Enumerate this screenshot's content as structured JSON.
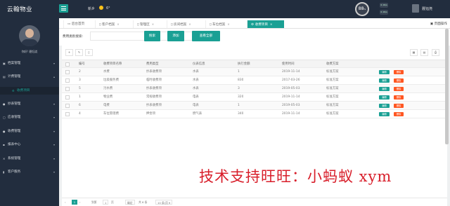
{
  "app": {
    "title": "云翰物业"
  },
  "topbar": {
    "city": "新乡",
    "temperature": "6°",
    "gauge": "88",
    "gauge_unit": "%",
    "stat_a": "0.1K/s",
    "stat_b": "0.1K/s",
    "user_name": "聂钰尧"
  },
  "sidebar": {
    "welcome": "你好! 聂钰尧",
    "items": [
      {
        "label": "档案管理",
        "icon": "archive-icon"
      },
      {
        "label": "计费管理",
        "icon": "billing-icon"
      },
      {
        "label": "收费项目",
        "icon": "gear-icon",
        "active": true
      },
      {
        "label": "抄表管理",
        "icon": "meter-icon"
      },
      {
        "label": "应收管理",
        "icon": "receivable-icon"
      },
      {
        "label": "收费管理",
        "icon": "cash-icon"
      },
      {
        "label": "报表中心",
        "icon": "report-icon"
      },
      {
        "label": "系统管理",
        "icon": "system-icon"
      },
      {
        "label": "客户服务",
        "icon": "service-icon"
      }
    ]
  },
  "tabs": [
    {
      "label": "后台首页",
      "closable": false
    },
    {
      "label": "客户档案",
      "closable": true
    },
    {
      "label": "管理区",
      "closable": true
    },
    {
      "label": "房间档案",
      "closable": true
    },
    {
      "label": "车位档案",
      "closable": true
    },
    {
      "label": "收费项目",
      "closable": true,
      "active": true
    }
  ],
  "page_ops": "页面操作",
  "search": {
    "label": "费用类别搜索:",
    "value": "",
    "search_button": "搜索",
    "add_button": "添加",
    "view_all_button": "查看全部"
  },
  "table": {
    "columns": [
      "",
      "编号",
      "收费项目名称",
      "费用类型",
      "仪表信息",
      "执行金额",
      "使用时间",
      "收费方案",
      ""
    ],
    "rows": [
      [
        "2",
        "水费",
        "抄表收费项",
        "水表",
        "1",
        "2019-11-14",
        "标准方案"
      ],
      [
        "3",
        "垃圾服务费",
        "临时收费项",
        "水表",
        "830",
        "2017-03-26",
        "标准方案"
      ],
      [
        "5",
        "污水费",
        "抄表收费项",
        "水表",
        "3",
        "2019-05-03",
        "标准方案"
      ],
      [
        "1",
        "物业费",
        "常规收费项",
        "电表",
        "320",
        "2019-11-14",
        "标准方案"
      ],
      [
        "6",
        "电费",
        "抄表收费项",
        "电表",
        "1",
        "2019-05-03",
        "标准方案"
      ],
      [
        "4",
        "车位管理费",
        "押金项",
        "燃气表",
        "340",
        "2019-11-14",
        "标准方案"
      ]
    ],
    "edit_label": "编辑",
    "delete_label": "删除"
  },
  "pager": {
    "current": "1",
    "goto_label": "到第",
    "goto_value": "1",
    "page_unit": "页",
    "confirm": "确定",
    "total": "共 6 条",
    "page_size": "10 条/页"
  },
  "watermark": "技术支持旺旺：小蚂蚁 xym",
  "colors": {
    "accent": "#1aa094",
    "danger": "#ff5722",
    "sidebar": "#222d3e"
  }
}
